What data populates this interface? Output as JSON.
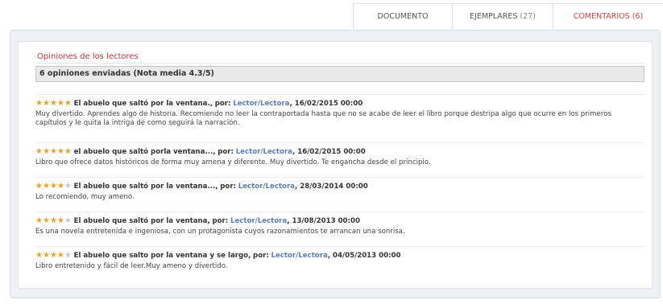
{
  "tabs": [
    {
      "label": "DOCUMENTO",
      "count": ""
    },
    {
      "label": "EJEMPLARES",
      "count": "(27)"
    },
    {
      "label": "COMENTARIOS",
      "count": "(6)"
    }
  ],
  "section_title": "Opiniones de los lectores",
  "summary": "6 opiniones enviadas (Nota media 4.3/5)",
  "reviews": [
    {
      "stars": 5,
      "title": "El abuelo que saltó por la ventana.,",
      "by": "por:",
      "author": "Lector/Lectora",
      "date": ", 16/02/2015 00:00",
      "text": "Muy divertido. Aprendes algo de historia. Recomiendo no leer la contraportada hasta que no se acabe de leer el libro porque destripa algo que ocurre en los primeros capítulos y le quita la intriga de como seguirá la narración."
    },
    {
      "stars": 5,
      "title": "el abuelo que saltó porla ventana...,",
      "by": "por:",
      "author": "Lector/Lectora",
      "date": ", 16/02/2015 00:00",
      "text": "Libro que ofrece datos históricos de forma muy amena y diferente. Muy divertido. Te engancha desde el principio."
    },
    {
      "stars": 4,
      "title": "El abuelo que saltó por la ventana...,",
      "by": "por:",
      "author": "Lector/Lectora",
      "date": ", 28/03/2014 00:00",
      "text": "Lo recomiendo, muy ameno."
    },
    {
      "stars": 4,
      "title": "El abuelo que saltó por la ventana,",
      "by": "por:",
      "author": "Lector/Lectora",
      "date": ", 13/08/2013 00:00",
      "text": "Es una novela entretenida e ingeniosa, con un protagonista cuyos razonamientos te arrancan una sonrisa."
    },
    {
      "stars": 4,
      "title": "El abuelo que salto por la ventana y se largo,",
      "by": "por:",
      "author": "Lector/Lectora",
      "date": ", 04/05/2013 00:00",
      "text": "Libro entretenido y fácil de leer.Muy ameno y divertido."
    }
  ],
  "colors": {
    "accent": "#c8333f",
    "link": "#5a7fb8",
    "star": "#e9a228"
  }
}
